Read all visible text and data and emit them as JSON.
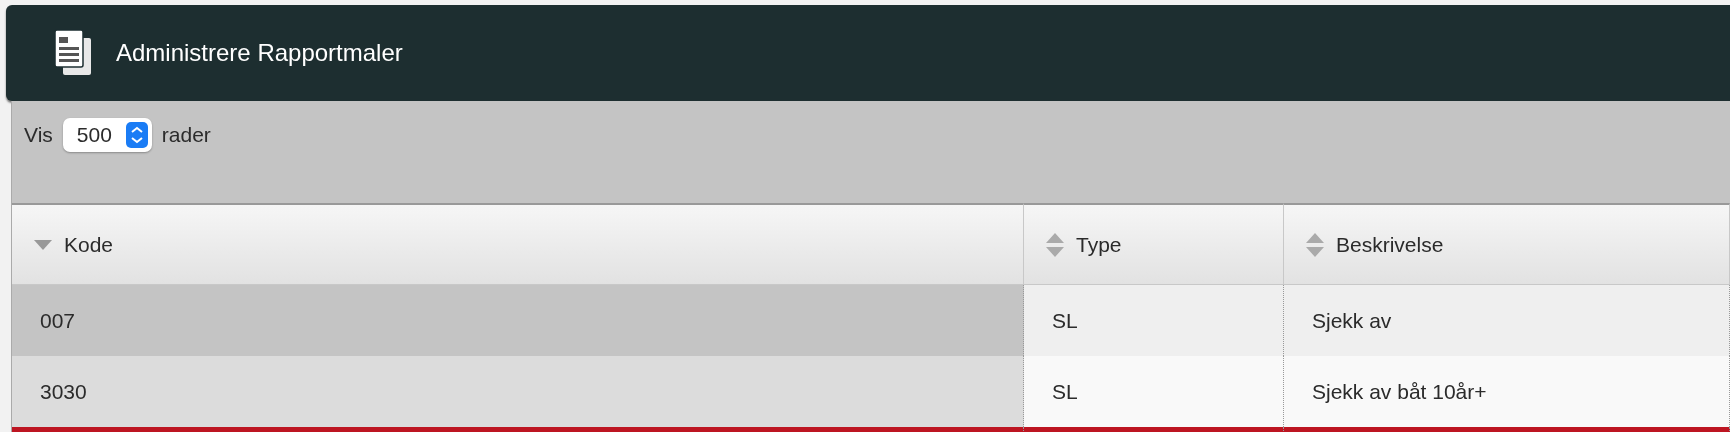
{
  "window": {
    "title": "Administrere Rapportmaler"
  },
  "length_control": {
    "label_before": "Vis",
    "value": "500",
    "label_after": "rader"
  },
  "table": {
    "columns": [
      {
        "label": "Kode",
        "kind": "descending"
      },
      {
        "label": "Type",
        "kind": "sortable"
      },
      {
        "label": "Beskrivelse",
        "kind": "sortable"
      }
    ],
    "rows": [
      {
        "selected": false,
        "cells": [
          "007",
          "SL",
          "Sjekk av"
        ]
      },
      {
        "selected": false,
        "cells": [
          "3030",
          "SL",
          "Sjekk av båt 10år+"
        ]
      },
      {
        "selected": true
      }
    ]
  }
}
